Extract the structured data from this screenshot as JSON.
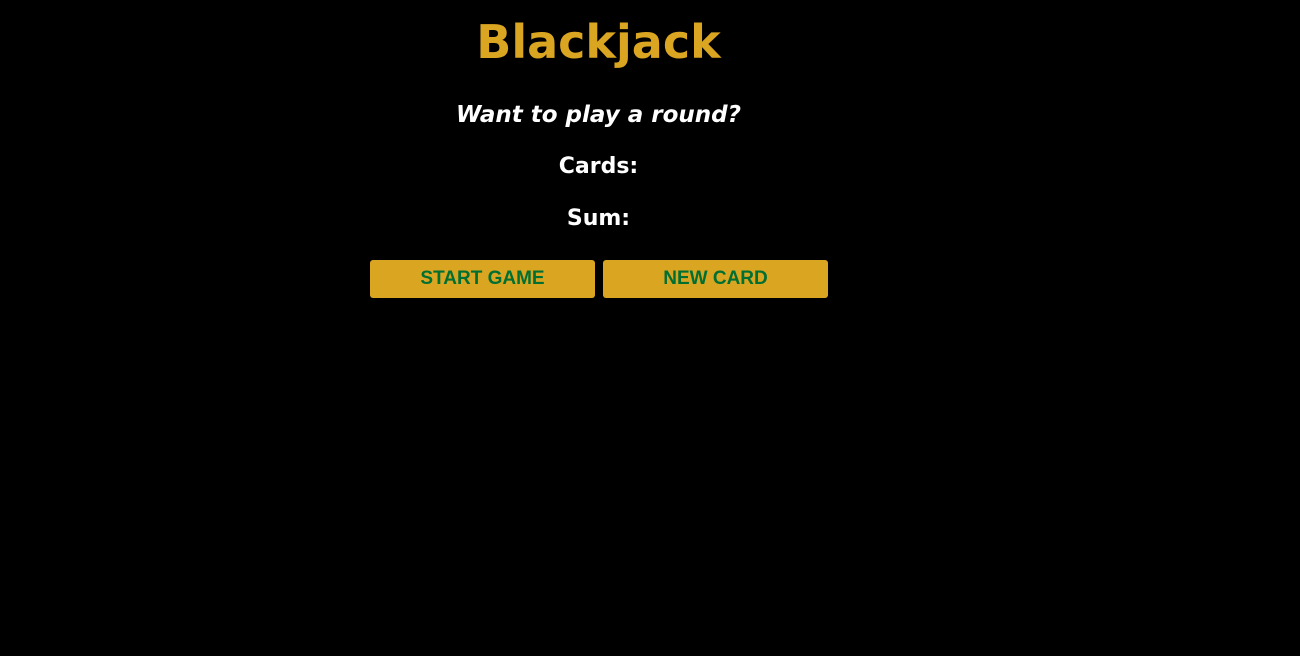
{
  "app": {
    "title": "Blackjack",
    "message": "Want to play a round?",
    "cards_label": "Cards:",
    "sum_label": "Sum:"
  },
  "buttons": {
    "start_label": "START GAME",
    "new_card_label": "NEW CARD"
  },
  "colors": {
    "background": "#000000",
    "accent": "#daa520",
    "button_text": "#016f32",
    "text": "#ffffff"
  }
}
